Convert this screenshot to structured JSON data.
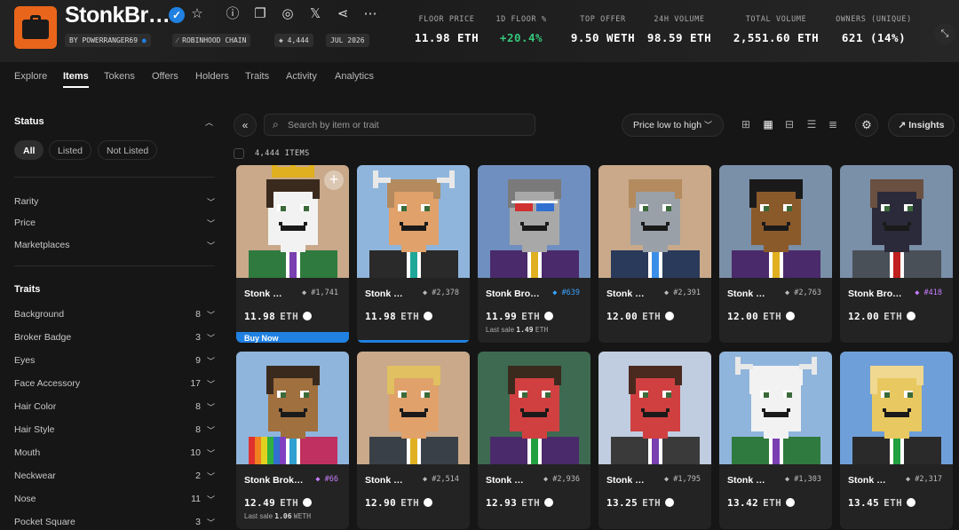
{
  "collection": {
    "title": "StonkBr…",
    "creator": "BY POWERRANGER69",
    "chain": "ROBINHOOD CHAIN",
    "supply": "4,444",
    "date": "JUL 2026"
  },
  "stats": [
    {
      "label": "FLOOR PRICE",
      "value": "11.98 ETH"
    },
    {
      "label": "1D FLOOR %",
      "value": "+20.4%"
    },
    {
      "label": "TOP OFFER",
      "value": "9.50 WETH"
    },
    {
      "label": "24H VOLUME",
      "value": "98.59 ETH"
    },
    {
      "label": "TOTAL VOLUME",
      "value": "2,551.60 ETH"
    },
    {
      "label": "OWNERS (UNIQUE)",
      "value": "621 (14%)"
    }
  ],
  "tabs": [
    "Explore",
    "Items",
    "Tokens",
    "Offers",
    "Holders",
    "Traits",
    "Activity",
    "Analytics"
  ],
  "sidebar": {
    "status_title": "Status",
    "status_chips": [
      "All",
      "Listed",
      "Not Listed"
    ],
    "filters": [
      "Rarity",
      "Price",
      "Marketplaces"
    ],
    "traits_title": "Traits",
    "traits": [
      {
        "label": "Background",
        "count": "8"
      },
      {
        "label": "Broker Badge",
        "count": "3"
      },
      {
        "label": "Eyes",
        "count": "9"
      },
      {
        "label": "Face Accessory",
        "count": "17"
      },
      {
        "label": "Hair Color",
        "count": "8"
      },
      {
        "label": "Hair Style",
        "count": "8"
      },
      {
        "label": "Mouth",
        "count": "10"
      },
      {
        "label": "Neckwear",
        "count": "2"
      },
      {
        "label": "Nose",
        "count": "11"
      },
      {
        "label": "Pocket Square",
        "count": "3"
      }
    ]
  },
  "toolbar": {
    "search_placeholder": "Search by item or trait",
    "sort_label": "Price low to high",
    "insights_label": "Insights",
    "items_count": "4,444 ITEMS"
  },
  "items": [
    {
      "name": "Stonk …",
      "token": "#1,741",
      "price": "11.98",
      "currency": "ETH",
      "last_sale": "",
      "bg": "#c9a98a",
      "skin": "#f2f2f2",
      "hair": "#3a2a1e",
      "shirt": "#2f7a3e",
      "tie": "#7a3fb0",
      "crown": true,
      "buy_now": "Buy Now"
    },
    {
      "name": "Stonk …",
      "token": "#2,378",
      "price": "11.98",
      "currency": "ETH",
      "last_sale": "",
      "bg": "#8fb5dc",
      "skin": "#e0a16a",
      "hair": "#b38b5e",
      "shirt": "#2a2a2a",
      "tie": "#1fa89a",
      "horns": true
    },
    {
      "name": "Stonk Bro…",
      "token": "#639",
      "price": "11.99",
      "currency": "ETH",
      "last_sale": "1.49",
      "bg": "#6f8fc0",
      "skin": "#a8a8a8",
      "hair": "#7a7a7a",
      "shirt": "#4a2a6a",
      "tie": "#e0b020",
      "glasses3d": true
    },
    {
      "name": "Stonk …",
      "token": "#2,391",
      "price": "12.00",
      "currency": "ETH",
      "last_sale": "",
      "bg": "#c9a98a",
      "skin": "#9aa0a8",
      "hair": "#b38b5e",
      "shirt": "#2a3a5a",
      "tie": "#3b8ee8"
    },
    {
      "name": "Stonk …",
      "token": "#2,763",
      "price": "12.00",
      "currency": "ETH",
      "last_sale": "",
      "bg": "#7a8fa8",
      "skin": "#8b5a2b",
      "hair": "#1a1a1a",
      "shirt": "#4a2a6a",
      "tie": "#e0b020"
    },
    {
      "name": "Stonk Bro…",
      "token": "#418",
      "price": "12.00",
      "currency": "ETH",
      "last_sale": "",
      "bg": "#7a8fa8",
      "skin": "#2a2a3a",
      "hair": "#6a5040",
      "shirt": "#4a5058",
      "tie": "#c02020"
    },
    {
      "name": "Stonk Brok…",
      "token": "#66",
      "price": "12.49",
      "currency": "ETH",
      "last_sale": "1.06",
      "bg": "#8fb5dc",
      "skin": "#a0703e",
      "hair": "#3a2a1e",
      "shirt": "#c03060",
      "tie": "#30a0d0",
      "rainbow": true
    },
    {
      "name": "Stonk …",
      "token": "#2,514",
      "price": "12.90",
      "currency": "ETH",
      "last_sale": "",
      "bg": "#c9a98a",
      "skin": "#e0a16a",
      "hair": "#e0c060",
      "shirt": "#3a4048",
      "tie": "#e0b020"
    },
    {
      "name": "Stonk …",
      "token": "#2,936",
      "price": "12.93",
      "currency": "ETH",
      "last_sale": "",
      "bg": "#3e6a52",
      "skin": "#d04040",
      "hair": "#3a2a1e",
      "shirt": "#4a2a6a",
      "tie": "#20a040"
    },
    {
      "name": "Stonk …",
      "token": "#1,795",
      "price": "13.25",
      "currency": "ETH",
      "last_sale": "",
      "bg": "#c0cde0",
      "skin": "#d04040",
      "hair": "#4a2a1e",
      "shirt": "#3a3a3a",
      "tie": "#7a3fb0"
    },
    {
      "name": "Stonk …",
      "token": "#1,303",
      "price": "13.42",
      "currency": "ETH",
      "last_sale": "",
      "bg": "#8fb5dc",
      "skin": "#f2f2f2",
      "hair": "#f2f2f2",
      "shirt": "#2f7a3e",
      "tie": "#7a3fb0",
      "horns": true
    },
    {
      "name": "Stonk …",
      "token": "#2,317",
      "price": "13.45",
      "currency": "ETH",
      "last_sale": "",
      "bg": "#6f9fd8",
      "skin": "#e8c860",
      "hair": "#f0d890",
      "shirt": "#2a2a2a",
      "tie": "#20a040"
    }
  ]
}
